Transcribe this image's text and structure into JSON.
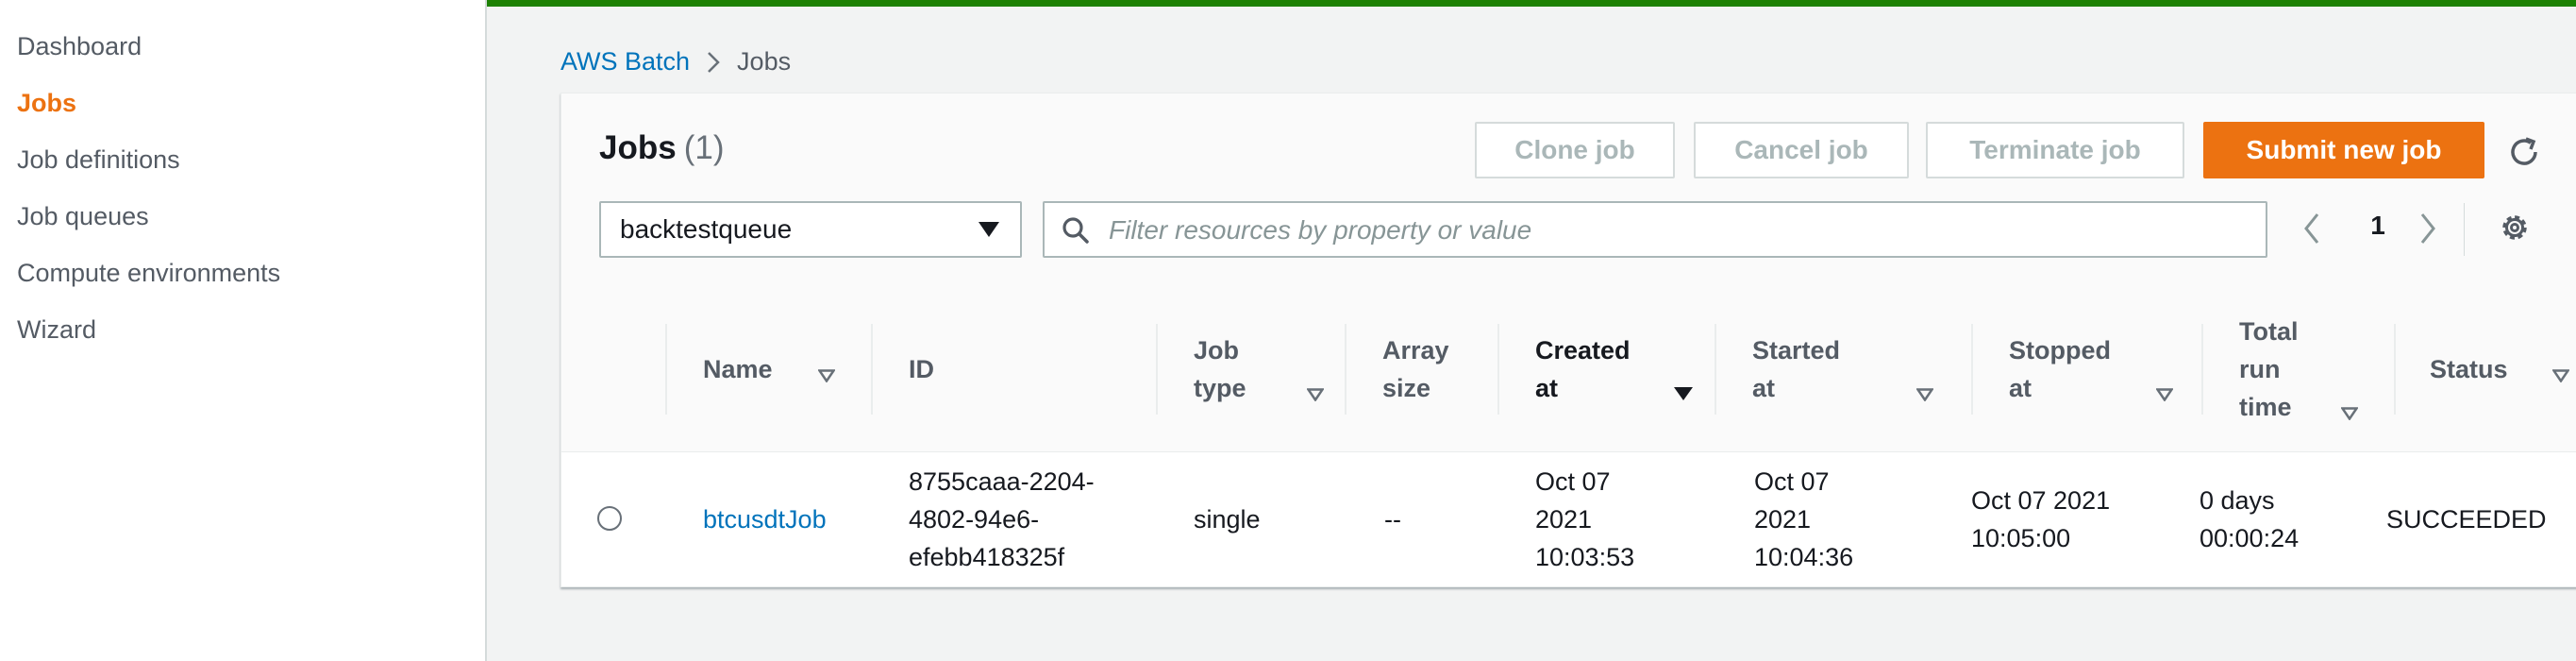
{
  "sidebar": {
    "items": [
      {
        "label": "Dashboard"
      },
      {
        "label": "Jobs",
        "active": true
      },
      {
        "label": "Job definitions"
      },
      {
        "label": "Job queues"
      },
      {
        "label": "Compute environments"
      },
      {
        "label": "Wizard"
      }
    ]
  },
  "breadcrumb": {
    "root": "AWS Batch",
    "current": "Jobs"
  },
  "jobs": {
    "title": "Jobs",
    "count": "(1)",
    "buttons": {
      "clone": "Clone job",
      "cancel": "Cancel job",
      "terminate": "Terminate job",
      "submit": "Submit new job"
    },
    "queue_select": "backtestqueue",
    "filter_placeholder": "Filter resources by property or value",
    "page": "1"
  },
  "table": {
    "columns": {
      "name": "Name",
      "id": "ID",
      "job_type_1": "Job",
      "job_type_2": "type",
      "array_1": "Array",
      "array_2": "size",
      "created_1": "Created",
      "created_2": "at",
      "started_1": "Started",
      "started_2": "at",
      "stopped_1": "Stopped",
      "stopped_2": "at",
      "total_1": "Total",
      "total_2": "run",
      "total_3": "time",
      "status": "Status"
    },
    "rows": [
      {
        "name": "btcusdtJob",
        "id_1": "8755caaa-2204-",
        "id_2": "4802-94e6-",
        "id_3": "efebb418325f",
        "job_type": "single",
        "array_size": "--",
        "created_1": "Oct 07",
        "created_2": "2021",
        "created_3": "10:03:53",
        "started_1": "Oct 07",
        "started_2": "2021",
        "started_3": "10:04:36",
        "stopped_1": "Oct 07 2021",
        "stopped_2": "10:05:00",
        "total_1": "0 days",
        "total_2": "00:00:24",
        "status": "SUCCEEDED"
      }
    ]
  },
  "colors": {
    "accent_orange": "#ec7211",
    "link_blue": "#0073bb",
    "success_bar": "#1d8102"
  }
}
